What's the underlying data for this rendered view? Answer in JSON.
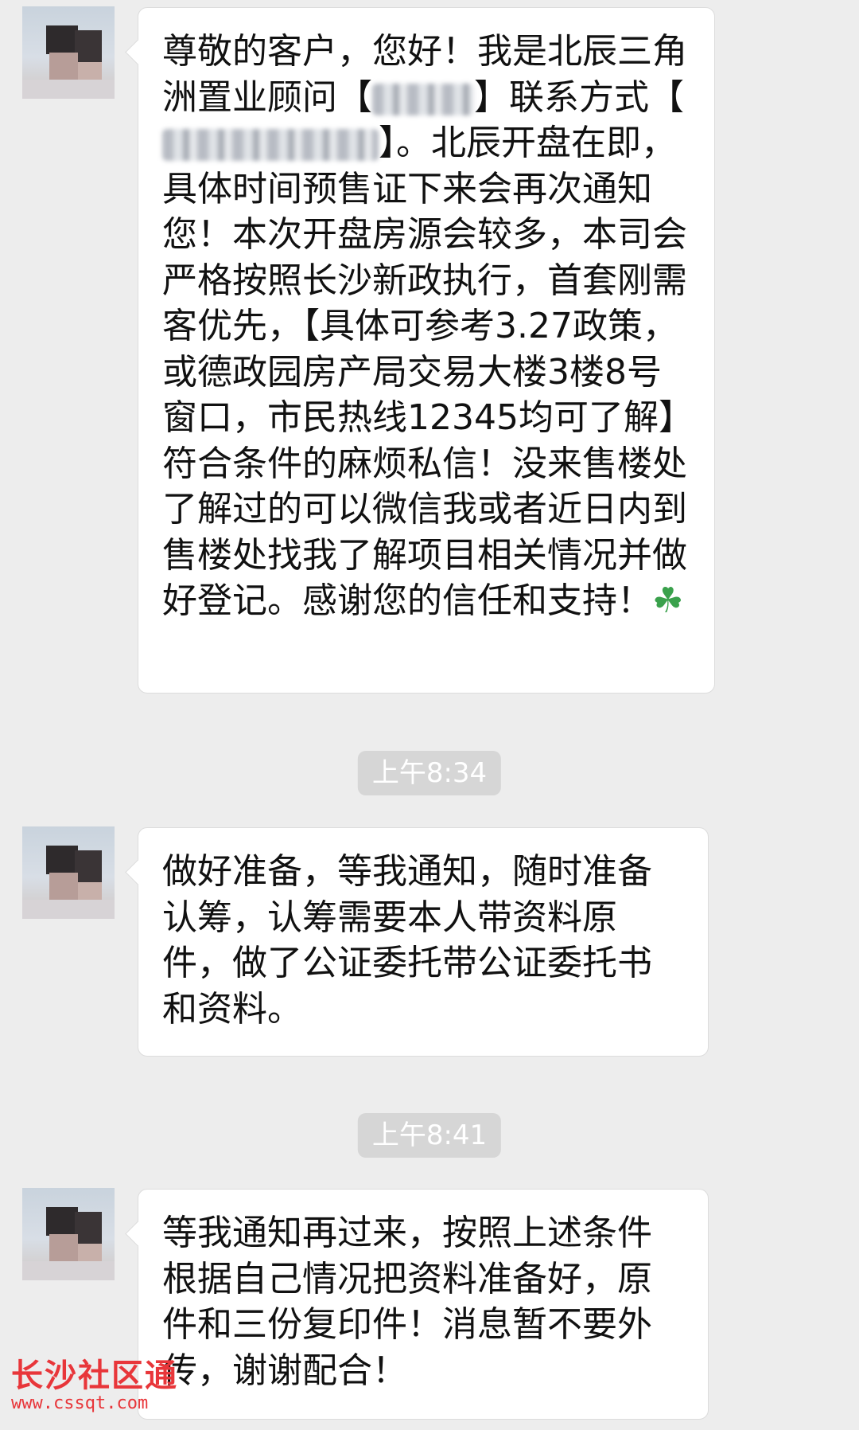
{
  "messages": [
    {
      "segments": [
        "尊敬的客户，您好！我是北辰三角洲置业顾问【",
        "】联系方式【",
        "】。北辰开盘在即，具体时间预售证下来会再次通知您！本次开盘房源会较多，本司会严格按照长沙新政执行，首套刚需客优先，【具体可参考3.27政策，或德政园房产局交易大楼3楼8号窗口，市民热线12345均可了解】符合条件的麻烦私信！没来售楼处了解过的可以微信我或者近日内到售楼处找我了解项目相关情况并做好登记。感谢您的信任和支持！"
      ],
      "emoji": "☘"
    },
    {
      "text": "做好准备，等我通知，随时准备认筹，认筹需要本人带资料原件，做了公证委托带公证委托书和资料。"
    },
    {
      "text": "等我通知再过来，按照上述条件根据自己情况把资料准备好，原件和三份复印件！消息暂不要外传，谢谢配合！"
    }
  ],
  "timestamps": [
    "上午8:34",
    "上午8:41"
  ],
  "watermark": {
    "title": "长沙社区通",
    "url": "www.cssqt.com"
  },
  "colors": {
    "background": "#ededed",
    "bubble": "#ffffff",
    "timestamp_bg": "#d6d6d6",
    "watermark": "#e8363a"
  }
}
